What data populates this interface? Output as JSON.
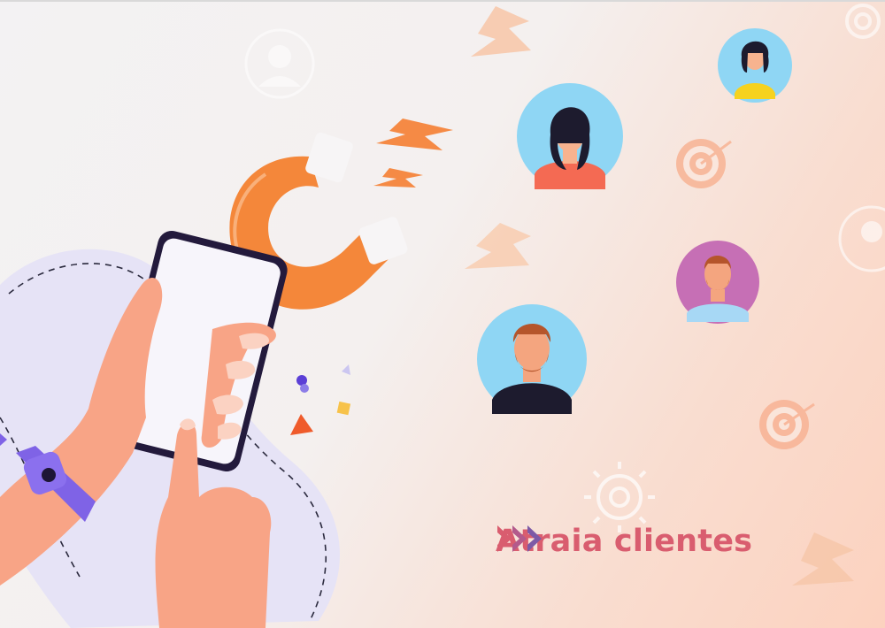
{
  "caption": {
    "text": "Atraia clientes",
    "arrow_colors": [
      "#d95d6f",
      "#b35a8c",
      "#7d5aa6"
    ]
  },
  "colors": {
    "magnet": "#f4873a",
    "magnet_tip": "#f7f5f6",
    "bolt": "#f58a45",
    "target": "#f6a47f",
    "phone_screen": "#f7f5fb",
    "phone_frame": "#231a3c",
    "skin": "#f8a486",
    "wristband": "#7f63e6",
    "blob": "#e6e3f6"
  },
  "icons": [
    "magnet-icon",
    "lightning-bolt-icon",
    "target-icon",
    "gear-icon",
    "user-avatar",
    "smartphone-illustration",
    "hand-illustration"
  ]
}
